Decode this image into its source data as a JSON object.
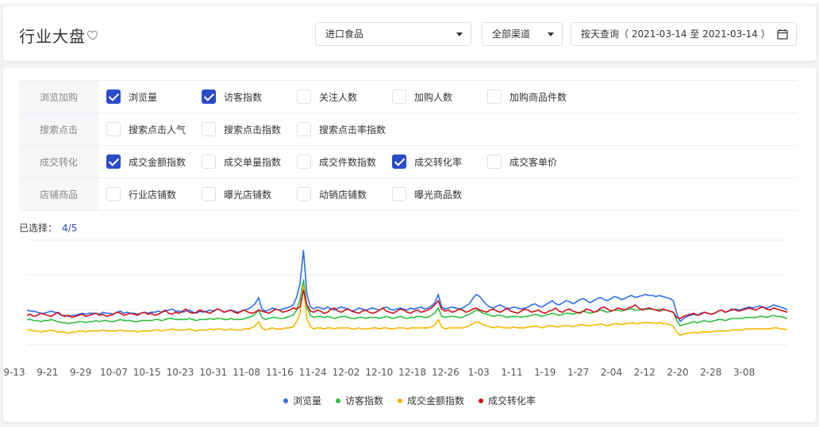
{
  "header": {
    "title": "行业大盘",
    "category_select": "进口食品",
    "channel_select": "全部渠道",
    "date_range": "按天查询（ 2021-03-14 至 2021-03-14 ）"
  },
  "filters": [
    {
      "label": "浏览加购",
      "items": [
        {
          "label": "浏览量",
          "checked": true
        },
        {
          "label": "访客指数",
          "checked": true
        },
        {
          "label": "关注人数",
          "checked": false
        },
        {
          "label": "加购人数",
          "checked": false
        },
        {
          "label": "加购商品件数",
          "checked": false
        }
      ]
    },
    {
      "label": "搜索点击",
      "items": [
        {
          "label": "搜索点击人气",
          "checked": false
        },
        {
          "label": "搜索点击指数",
          "checked": false
        },
        {
          "label": "搜索点击率指数",
          "checked": false
        }
      ]
    },
    {
      "label": "成交转化",
      "items": [
        {
          "label": "成交金额指数",
          "checked": true
        },
        {
          "label": "成交单量指数",
          "checked": false
        },
        {
          "label": "成交件数指数",
          "checked": false
        },
        {
          "label": "成交转化率",
          "checked": true
        },
        {
          "label": "成交客单价",
          "checked": false
        }
      ]
    },
    {
      "label": "店铺商品",
      "items": [
        {
          "label": "行业店铺数",
          "checked": false
        },
        {
          "label": "曝光店铺数",
          "checked": false
        },
        {
          "label": "动销店铺数",
          "checked": false
        },
        {
          "label": "曝光商品数",
          "checked": false
        }
      ]
    }
  ],
  "selection": {
    "label": "已选择：",
    "count": "4/5"
  },
  "colors": {
    "accent": "#2b4cc9",
    "blue": "#2f6cf2",
    "green": "#2fbf3f",
    "yellow": "#f5b800",
    "red": "#d0101a"
  },
  "chart_data": {
    "type": "line",
    "x_tick_labels": [
      "9-13",
      "9-21",
      "9-29",
      "10-07",
      "10-15",
      "10-23",
      "10-31",
      "11-08",
      "11-16",
      "11-24",
      "12-02",
      "12-10",
      "12-18",
      "12-26",
      "1-03",
      "1-11",
      "1-19",
      "1-27",
      "2-04",
      "2-12",
      "2-20",
      "2-28",
      "3-08"
    ],
    "ylim": [
      0,
      100
    ],
    "grid": true,
    "legend_position": "bottom",
    "series": [
      {
        "name": "浏览量",
        "color": "#2f6cf2",
        "values": [
          33,
          32,
          32,
          31,
          30,
          30,
          31,
          32,
          31,
          30,
          28,
          28,
          27,
          28,
          28,
          29,
          30,
          29,
          30,
          30,
          30,
          29,
          31,
          30,
          30,
          29,
          31,
          32,
          30,
          31,
          30,
          30,
          29,
          30,
          31,
          30,
          31,
          31,
          32,
          31,
          32,
          33,
          34,
          32,
          32,
          31,
          32,
          33,
          31,
          30,
          32,
          31,
          32,
          33,
          32,
          34,
          33,
          31,
          32,
          33,
          32,
          31,
          32,
          33,
          34,
          36,
          39,
          45,
          34,
          32,
          33,
          35,
          34,
          33,
          34,
          35,
          36,
          38,
          45,
          58,
          90,
          48,
          36,
          34,
          36,
          35,
          34,
          36,
          34,
          33,
          35,
          36,
          35,
          34,
          32,
          33,
          35,
          34,
          33,
          34,
          35,
          34,
          33,
          35,
          36,
          34,
          33,
          34,
          35,
          34,
          33,
          35,
          34,
          35,
          36,
          34,
          35,
          37,
          40,
          48,
          36,
          34,
          35,
          36,
          35,
          34,
          35,
          37,
          39,
          44,
          48,
          46,
          42,
          38,
          36,
          35,
          37,
          38,
          36,
          34,
          35,
          36,
          35,
          34,
          35,
          36,
          38,
          39,
          37,
          36,
          38,
          40,
          42,
          39,
          38,
          40,
          42,
          41,
          39,
          41,
          43,
          44,
          42,
          40,
          42,
          44,
          45,
          43,
          42,
          44,
          46,
          45,
          43,
          44,
          46,
          47,
          45,
          46,
          47,
          48,
          47,
          47,
          46,
          47,
          46,
          45,
          44,
          42,
          30,
          22,
          25,
          27,
          28,
          29,
          28,
          30,
          31,
          30,
          29,
          30,
          32,
          33,
          31,
          32,
          33,
          34,
          33,
          34,
          35,
          36,
          35,
          36,
          37,
          36,
          35,
          36,
          38,
          37,
          36,
          35,
          33
        ]
      },
      {
        "name": "访客指数",
        "color": "#2fbf3f",
        "values": [
          24,
          24,
          23,
          23,
          22,
          23,
          23,
          24,
          23,
          22,
          21,
          21,
          20,
          21,
          21,
          22,
          22,
          21,
          22,
          22,
          23,
          22,
          23,
          23,
          22,
          22,
          23,
          24,
          23,
          23,
          23,
          22,
          22,
          23,
          23,
          23,
          23,
          24,
          24,
          23,
          24,
          25,
          25,
          24,
          24,
          24,
          24,
          25,
          24,
          23,
          24,
          24,
          24,
          25,
          24,
          25,
          25,
          24,
          24,
          25,
          24,
          24,
          24,
          25,
          26,
          27,
          29,
          33,
          26,
          24,
          25,
          26,
          26,
          25,
          25,
          26,
          27,
          28,
          33,
          43,
          62,
          36,
          28,
          26,
          27,
          27,
          26,
          27,
          26,
          25,
          26,
          27,
          27,
          26,
          25,
          25,
          26,
          26,
          25,
          26,
          26,
          26,
          25,
          26,
          27,
          26,
          25,
          26,
          27,
          26,
          25,
          26,
          26,
          27,
          27,
          26,
          26,
          28,
          30,
          35,
          27,
          26,
          27,
          27,
          27,
          26,
          26,
          28,
          29,
          31,
          33,
          32,
          30,
          29,
          28,
          27,
          28,
          28,
          27,
          26,
          27,
          27,
          27,
          26,
          27,
          27,
          28,
          29,
          28,
          27,
          28,
          29,
          30,
          29,
          28,
          29,
          30,
          30,
          29,
          30,
          31,
          32,
          31,
          30,
          31,
          32,
          33,
          32,
          31,
          32,
          33,
          33,
          32,
          33,
          34,
          34,
          33,
          33,
          34,
          34,
          34,
          34,
          33,
          34,
          33,
          33,
          32,
          31,
          23,
          18,
          19,
          20,
          21,
          22,
          21,
          22,
          23,
          22,
          22,
          23,
          24,
          24,
          23,
          24,
          25,
          25,
          25,
          25,
          26,
          26,
          26,
          26,
          27,
          27,
          26,
          27,
          28,
          27,
          27,
          26,
          25
        ]
      },
      {
        "name": "成交金额指数",
        "color": "#f5b800",
        "values": [
          14,
          14,
          13,
          13,
          12,
          13,
          13,
          14,
          13,
          12,
          12,
          12,
          11,
          12,
          12,
          13,
          13,
          12,
          13,
          13,
          13,
          13,
          14,
          13,
          13,
          13,
          13,
          14,
          13,
          13,
          13,
          13,
          12,
          13,
          13,
          13,
          13,
          14,
          14,
          13,
          14,
          14,
          15,
          14,
          14,
          14,
          14,
          15,
          14,
          13,
          14,
          14,
          14,
          15,
          14,
          15,
          15,
          14,
          14,
          15,
          14,
          14,
          14,
          15,
          15,
          16,
          18,
          22,
          16,
          14,
          15,
          16,
          15,
          15,
          15,
          16,
          16,
          17,
          22,
          30,
          56,
          25,
          17,
          15,
          16,
          16,
          15,
          16,
          16,
          15,
          16,
          16,
          16,
          16,
          15,
          15,
          16,
          15,
          15,
          15,
          16,
          16,
          15,
          16,
          16,
          15,
          15,
          16,
          16,
          16,
          15,
          16,
          16,
          16,
          16,
          16,
          16,
          17,
          19,
          24,
          17,
          15,
          16,
          16,
          16,
          16,
          16,
          17,
          18,
          20,
          22,
          21,
          19,
          18,
          17,
          16,
          17,
          17,
          16,
          16,
          16,
          17,
          16,
          16,
          16,
          17,
          17,
          18,
          17,
          16,
          17,
          18,
          18,
          17,
          17,
          18,
          18,
          18,
          17,
          18,
          19,
          19,
          18,
          18,
          19,
          19,
          20,
          19,
          18,
          19,
          20,
          20,
          19,
          20,
          20,
          21,
          20,
          20,
          21,
          21,
          21,
          21,
          20,
          21,
          20,
          20,
          19,
          18,
          12,
          9,
          10,
          11,
          11,
          12,
          11,
          12,
          12,
          12,
          12,
          13,
          13,
          13,
          13,
          13,
          14,
          14,
          14,
          14,
          15,
          15,
          15,
          15,
          15,
          15,
          15,
          15,
          16,
          16,
          15,
          15,
          14
        ]
      },
      {
        "name": "成交转化率",
        "color": "#d0101a",
        "values": [
          28,
          29,
          27,
          28,
          30,
          29,
          28,
          27,
          29,
          31,
          28,
          27,
          28,
          26,
          27,
          28,
          29,
          27,
          28,
          29,
          30,
          28,
          29,
          27,
          28,
          29,
          31,
          30,
          28,
          29,
          30,
          29,
          28,
          30,
          31,
          29,
          30,
          28,
          29,
          31,
          33,
          30,
          29,
          31,
          30,
          32,
          34,
          31,
          30,
          31,
          33,
          32,
          31,
          30,
          32,
          34,
          33,
          31,
          32,
          33,
          31,
          30,
          32,
          33,
          31,
          30,
          31,
          33,
          32,
          31,
          30,
          32,
          34,
          33,
          31,
          32,
          33,
          35,
          34,
          36,
          52,
          38,
          32,
          31,
          33,
          32,
          30,
          31,
          34,
          35,
          32,
          31,
          33,
          34,
          32,
          31,
          30,
          32,
          33,
          31,
          30,
          31,
          33,
          35,
          32,
          31,
          30,
          32,
          34,
          33,
          31,
          30,
          32,
          33,
          31,
          32,
          33,
          35,
          38,
          42,
          34,
          32,
          33,
          31,
          32,
          34,
          33,
          31,
          32,
          34,
          35,
          33,
          32,
          31,
          33,
          34,
          32,
          31,
          33,
          35,
          32,
          31,
          30,
          32,
          34,
          33,
          31,
          32,
          33,
          31,
          30,
          32,
          33,
          35,
          32,
          31,
          33,
          34,
          32,
          31,
          30,
          32,
          34,
          33,
          31,
          32,
          35,
          36,
          34,
          32,
          33,
          35,
          34,
          33,
          35,
          36,
          38,
          35,
          33,
          34,
          35,
          34,
          33,
          32,
          34,
          33,
          32,
          31,
          26,
          25,
          27,
          28,
          29,
          30,
          28,
          29,
          31,
          30,
          29,
          30,
          32,
          33,
          31,
          32,
          34,
          33,
          32,
          33,
          34,
          35,
          34,
          33,
          35,
          36,
          34,
          33,
          35,
          34,
          33,
          32,
          31
        ]
      }
    ]
  }
}
